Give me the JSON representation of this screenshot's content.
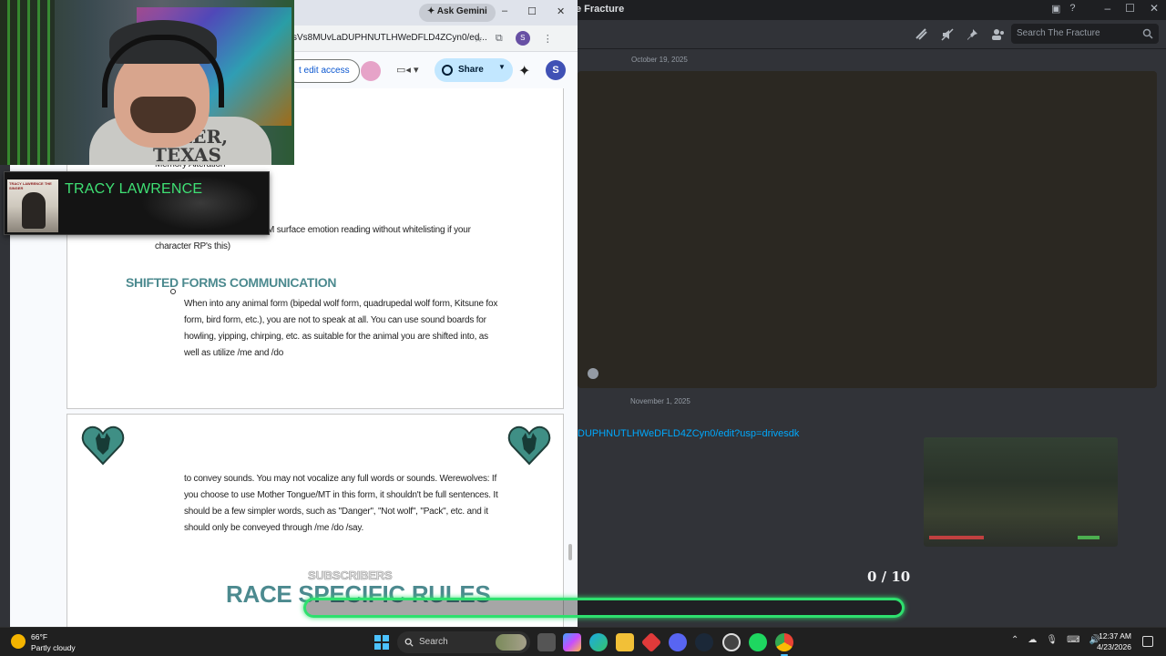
{
  "discord": {
    "window_title": "e Fracture",
    "search_placeholder": "Search The Fracture",
    "date_1": "October 19, 2025",
    "date_2": "November 1, 2025",
    "link": "DUPHNUTLHWeDFLD4ZCyn0/edit?usp=drivesdk",
    "counter": "0 / 10",
    "colors": {
      "background": "#313338",
      "link": "#00a8fc",
      "overlay_green": "#2ee06e"
    }
  },
  "browser": {
    "ask_gemini": "Ask Gemini",
    "url": "sVs8MUvLaDUPHNUTLHWeDFLD4ZCyn0/ed...",
    "profile_initial": "S",
    "edit_access_label": "t edit access",
    "share_label": "Share",
    "profile_big_initial": "S"
  },
  "doc": {
    "memory_alteration": "Memory Alteration",
    "mind_reading": "Mind Reading (you may TOTM surface emotion reading without whitelisting if your character RP's this)",
    "shifted_heading": "SHIFTED FORMS COMMUNICATION",
    "shifted_bullet": "When into any animal form (bipedal wolf form, quadrupedal wolf form, Kitsune fox form, bird form, etc.), you are not to speak at all. You can use sound boards for howling, yipping, chirping, etc. as suitable for the animal you are shifted into, as well as utilize /me and /do",
    "page2_para": "to convey sounds. You may not vocalize any full words or sounds. Werewolves: If you choose to use Mother Tongue/MT in this form, it shouldn't be full sentences. It should be a few simpler words, such as \"Danger\", \"Not wolf\", \"Pack\", etc. and it should only be conveyed through /me /do /say.",
    "race_heading": "RACE SPECIFIC RULES",
    "subscribers_overlay": "SUBSCRIBERS",
    "heading_color": "#4c8a8f"
  },
  "webcam": {
    "shirt_text": "TYLER,\nTEXAS"
  },
  "now_playing": {
    "title": "TRACY LAWRENCE",
    "art_text": "TRACY LAWRENCE THE SINGER",
    "title_color": "#3fe074"
  },
  "taskbar": {
    "temperature": "66°F",
    "condition": "Partly cloudy",
    "search_label": "Search",
    "time": "12:37 AM",
    "date": "4/23/2026",
    "apps": [
      "file-explorer",
      "copilot",
      "edge",
      "folder",
      "app-red",
      "discord",
      "steam",
      "github",
      "spotify",
      "chrome"
    ]
  }
}
